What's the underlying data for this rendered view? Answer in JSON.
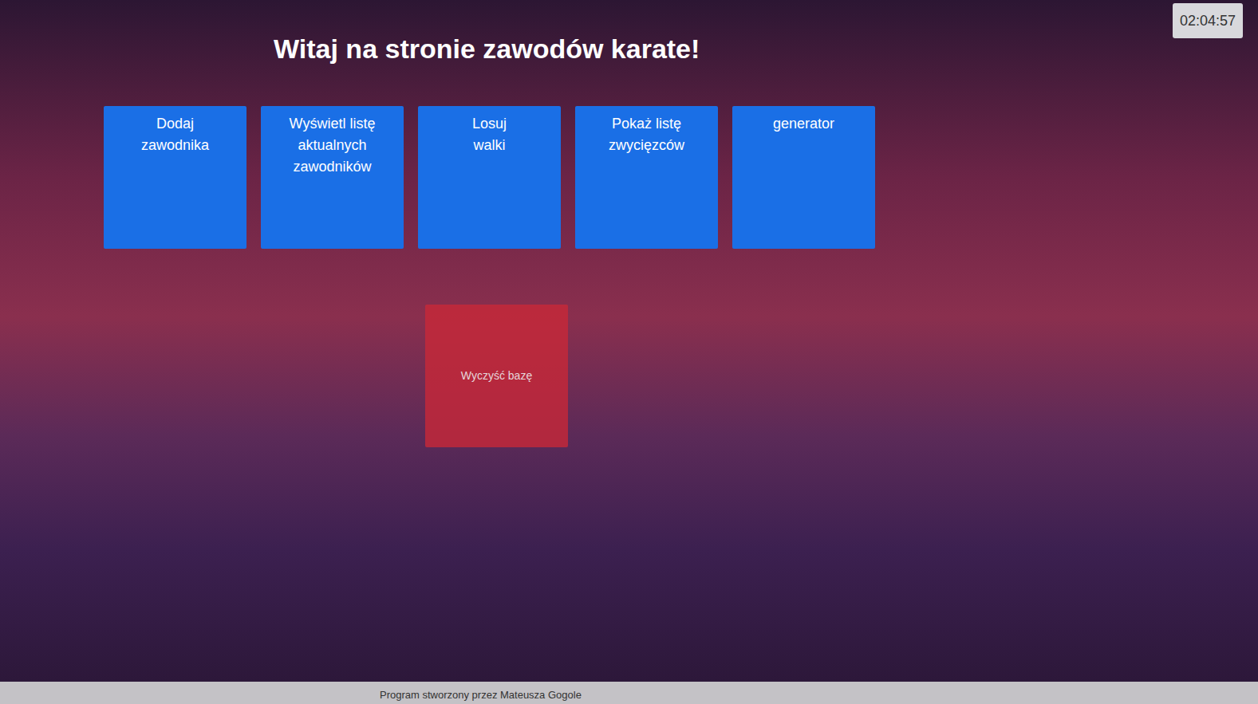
{
  "page": {
    "heading": "Witaj na stronie zawodów karate!",
    "clock": "02:04:57"
  },
  "tiles": [
    {
      "lines": [
        "Dodaj",
        "zawodnika"
      ]
    },
    {
      "lines": [
        "Wyświetl listę",
        "aktualnych",
        "zawodników"
      ]
    },
    {
      "lines": [
        "Losuj",
        "walki"
      ]
    },
    {
      "lines": [
        "Pokaż listę",
        "zwycięzców"
      ]
    },
    {
      "lines": [
        "generator"
      ]
    }
  ],
  "danger_tile": {
    "label": "Wyczyść bazę"
  },
  "footer": {
    "text": "Program stworzony przez Mateusza Gogole"
  }
}
